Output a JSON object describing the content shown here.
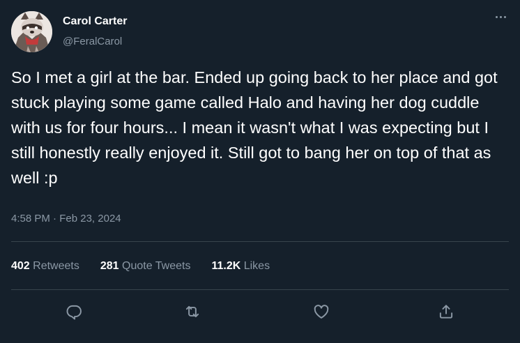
{
  "author": {
    "name": "Carol Carter",
    "handle": "@FeralCarol",
    "avatar_icon": "raccoon-avatar"
  },
  "tweet": {
    "text": "So I met a girl at the bar. Ended up going back to her place and got stuck playing some game called Halo and having her dog cuddle with us for four hours... I mean it wasn't what I was expecting but I still honestly really enjoyed it. Still got to bang her on top of that as well :p",
    "time": "4:58 PM",
    "separator": "·",
    "date": "Feb 23, 2024"
  },
  "stats": {
    "retweets_count": "402",
    "retweets_label": "Retweets",
    "quotes_count": "281",
    "quotes_label": "Quote Tweets",
    "likes_count": "11.2K",
    "likes_label": "Likes"
  },
  "actions": [
    {
      "icon": "reply-icon"
    },
    {
      "icon": "retweet-icon"
    },
    {
      "icon": "like-icon"
    },
    {
      "icon": "share-icon"
    }
  ],
  "colors": {
    "background": "#15202b",
    "primary_text": "#ffffff",
    "secondary_text": "#8b98a5",
    "divider": "#38444d"
  }
}
